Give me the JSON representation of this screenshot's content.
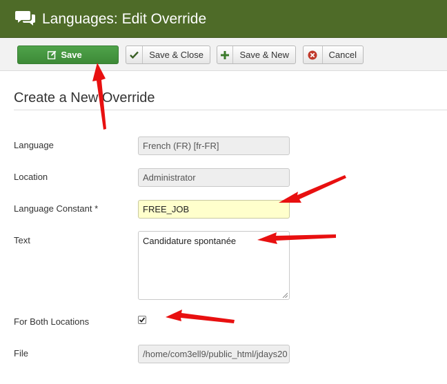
{
  "header": {
    "title": "Languages: Edit Override",
    "icon": "comments-icon"
  },
  "toolbar": {
    "save_label": "Save",
    "save_close_label": "Save & Close",
    "save_new_label": "Save & New",
    "cancel_label": "Cancel"
  },
  "form": {
    "heading": "Create a New Override",
    "language": {
      "label": "Language",
      "value": "French (FR) [fr-FR]"
    },
    "location": {
      "label": "Location",
      "value": "Administrator"
    },
    "constant": {
      "label": "Language Constant *",
      "value": "FREE_JOB"
    },
    "text": {
      "label": "Text",
      "value": "Candidature spontanée"
    },
    "both_locations": {
      "label": "For Both Locations",
      "checked": true
    },
    "file": {
      "label": "File",
      "value": "/home/com3ell9/public_html/jdays20"
    }
  },
  "colors": {
    "header_bg": "#4e6b28",
    "save_button": "#4fa34a",
    "highlight_field": "#ffffcc",
    "annotation_arrow": "#e81010",
    "cancel_icon": "#c0392b"
  }
}
